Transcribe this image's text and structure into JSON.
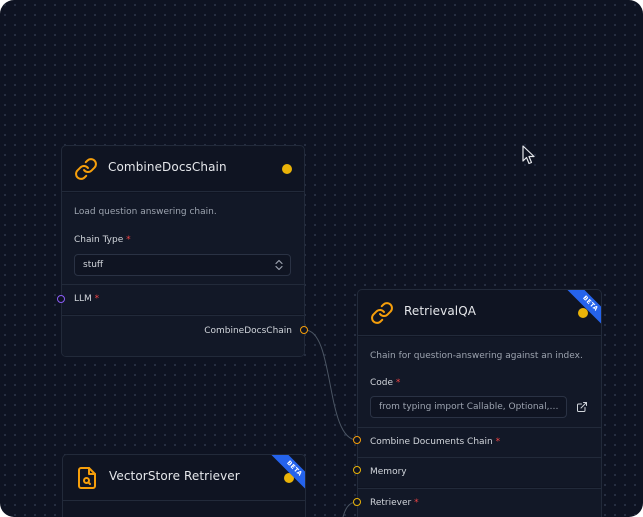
{
  "nodes": {
    "combine_docs": {
      "title": "CombineDocsChain",
      "icon": "link-icon",
      "description": "Load question answering chain.",
      "chain_type_label": "Chain Type",
      "chain_type_value": "stuff",
      "llm_label": "LLM",
      "output_label": "CombineDocsChain"
    },
    "retrieval_qa": {
      "title": "RetrievalQA",
      "icon": "link-icon",
      "badge": "BETA",
      "description": "Chain for question-answering against an index.",
      "code_label": "Code",
      "code_value": "from typing import Callable, Optional, Uni...",
      "combine_docs_label": "Combine Documents Chain",
      "memory_label": "Memory",
      "retriever_label": "Retriever"
    },
    "vectorstore_retriever": {
      "title": "VectorStore Retriever",
      "icon": "file-search-icon",
      "badge": "BETA"
    }
  },
  "required_marker": "*",
  "colors": {
    "background": "#0e1322",
    "status_dot": "#eab308",
    "required": "#ef4444",
    "beta_badge": "#2563eb",
    "icon_accent": "#f59e0b"
  }
}
